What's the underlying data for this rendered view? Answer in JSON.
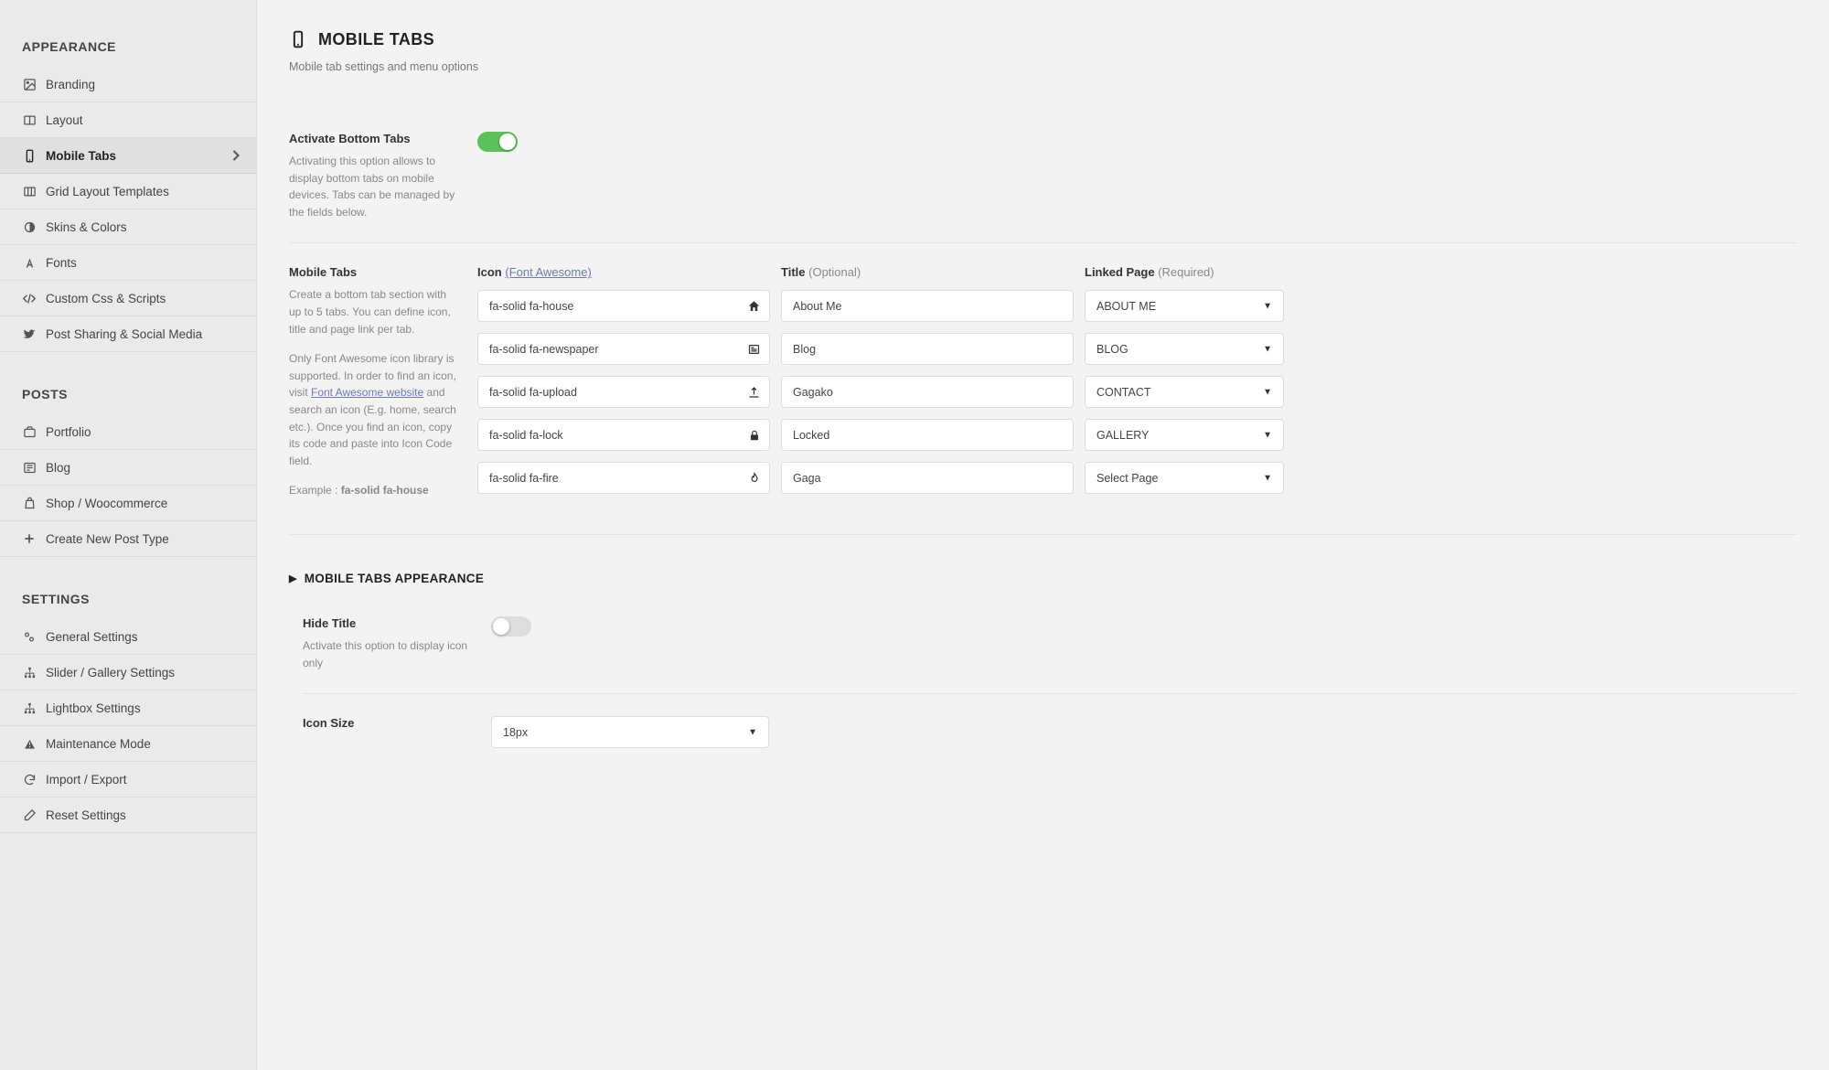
{
  "sidebar": {
    "sections": [
      {
        "label": "APPEARANCE",
        "items": [
          {
            "label": "Branding",
            "icon": "image-icon"
          },
          {
            "label": "Layout",
            "icon": "columns-icon"
          },
          {
            "label": "Mobile Tabs",
            "icon": "phone-icon",
            "active": true
          },
          {
            "label": "Grid Layout Templates",
            "icon": "grid-icon"
          },
          {
            "label": "Skins & Colors",
            "icon": "contrast-icon"
          },
          {
            "label": "Fonts",
            "icon": "font-icon"
          },
          {
            "label": "Custom Css & Scripts",
            "icon": "code-icon"
          },
          {
            "label": "Post Sharing & Social Media",
            "icon": "twitter-icon"
          }
        ]
      },
      {
        "label": "POSTS",
        "items": [
          {
            "label": "Portfolio",
            "icon": "briefcase-icon"
          },
          {
            "label": "Blog",
            "icon": "newspaper-icon"
          },
          {
            "label": "Shop / Woocommerce",
            "icon": "bag-icon"
          },
          {
            "label": "Create New Post Type",
            "icon": "plus-icon"
          }
        ]
      },
      {
        "label": "SETTINGS",
        "items": [
          {
            "label": "General Settings",
            "icon": "gears-icon"
          },
          {
            "label": "Slider / Gallery Settings",
            "icon": "sitemap-icon"
          },
          {
            "label": "Lightbox Settings",
            "icon": "sitemap-icon"
          },
          {
            "label": "Maintenance Mode",
            "icon": "warning-icon"
          },
          {
            "label": "Import / Export",
            "icon": "refresh-icon"
          },
          {
            "label": "Reset Settings",
            "icon": "eraser-icon"
          }
        ]
      }
    ]
  },
  "page": {
    "title": "MOBILE TABS",
    "subtitle": "Mobile tab settings and menu options"
  },
  "activate": {
    "label": "Activate Bottom Tabs",
    "desc": "Activating this option allows to display bottom tabs on mobile devices. Tabs can be managed by the fields below.",
    "on": true
  },
  "mobileTabs": {
    "label": "Mobile Tabs",
    "desc1": "Create a bottom tab section with up to 5 tabs. You can define icon, title and page link per tab.",
    "desc2a": "Only Font Awesome icon library is supported. In order to find an icon, visit ",
    "desc2link": "Font Awesome website",
    "desc2b": " and search an icon (E.g. home, search etc.). Once you find an icon, copy its code and paste into Icon Code field.",
    "exampleLabel": "Example : ",
    "exampleVal": "fa-solid fa-house",
    "headers": {
      "icon": "Icon",
      "iconLink": "(Font Awesome)",
      "title": "Title",
      "titleHint": "(Optional)",
      "page": "Linked Page",
      "pageHint": "(Required)"
    },
    "rows": [
      {
        "icon": "fa-solid fa-house",
        "glyph": "house-icon",
        "title": "About Me",
        "page": "ABOUT ME"
      },
      {
        "icon": "fa-solid fa-newspaper",
        "glyph": "newspaper-icon",
        "title": "Blog",
        "page": "BLOG"
      },
      {
        "icon": "fa-solid fa-upload",
        "glyph": "upload-icon",
        "title": "Gagako",
        "page": "CONTACT"
      },
      {
        "icon": "fa-solid fa-lock",
        "glyph": "lock-icon",
        "title": "Locked",
        "page": "GALLERY"
      },
      {
        "icon": "fa-solid fa-fire",
        "glyph": "fire-icon",
        "title": "Gaga",
        "page": "Select Page"
      }
    ]
  },
  "appearanceSection": {
    "title": "MOBILE TABS APPEARANCE"
  },
  "hideTitle": {
    "label": "Hide Title",
    "desc": "Activate this option to display icon only",
    "on": false
  },
  "iconSize": {
    "label": "Icon Size",
    "value": "18px"
  }
}
